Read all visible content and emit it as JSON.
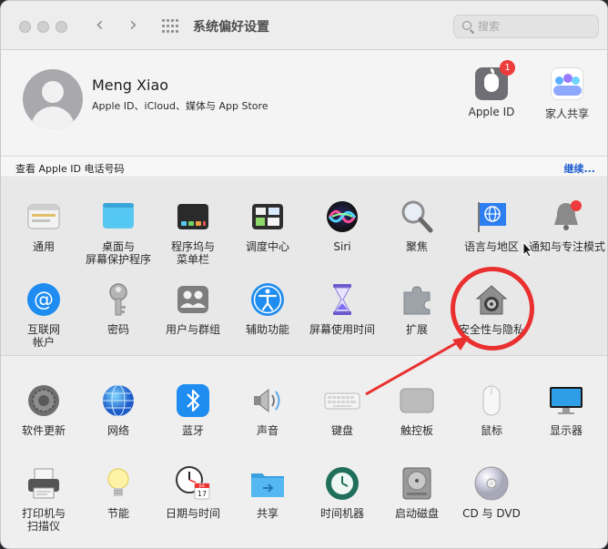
{
  "window": {
    "title": "系统偏好设置"
  },
  "search": {
    "placeholder": "搜索"
  },
  "profile": {
    "name": "Meng Xiao",
    "subtitle": "Apple ID、iCloud、媒体与 App Store",
    "apple_id": {
      "label": "Apple ID",
      "badge": "1"
    },
    "family": {
      "label": "家人共享"
    }
  },
  "appleid_row": {
    "left": "查看 Apple ID 电话号码",
    "right": "继续..."
  },
  "section_a": [
    {
      "name": "general",
      "label": "通用",
      "icon": "general-icon"
    },
    {
      "name": "desktop-screensaver",
      "label": "桌面与\n屏幕保护程序",
      "icon": "desktop-icon"
    },
    {
      "name": "dock-menubar",
      "label": "程序坞与\n菜单栏",
      "icon": "dock-icon"
    },
    {
      "name": "mission-control",
      "label": "调度中心",
      "icon": "mission-control-icon"
    },
    {
      "name": "siri",
      "label": "Siri",
      "icon": "siri-icon"
    },
    {
      "name": "spotlight",
      "label": "聚焦",
      "icon": "spotlight-icon"
    },
    {
      "name": "language-region",
      "label": "语言与地区",
      "icon": "globe-flag-icon"
    },
    {
      "name": "notifications-focus",
      "label": "通知与专注模式",
      "icon": "bell-icon"
    },
    {
      "name": "internet-accounts",
      "label": "互联网\n帐户",
      "icon": "at-icon"
    },
    {
      "name": "passwords",
      "label": "密码",
      "icon": "key-icon"
    },
    {
      "name": "users-groups",
      "label": "用户与群组",
      "icon": "users-icon"
    },
    {
      "name": "accessibility",
      "label": "辅助功能",
      "icon": "accessibility-icon"
    },
    {
      "name": "screen-time",
      "label": "屏幕使用时间",
      "icon": "hourglass-icon"
    },
    {
      "name": "extensions",
      "label": "扩展",
      "icon": "puzzle-icon"
    },
    {
      "name": "security-privacy",
      "label": "安全性与隐私",
      "icon": "house-lock-icon"
    }
  ],
  "section_b": [
    {
      "name": "software-update",
      "label": "软件更新",
      "icon": "gear-icon"
    },
    {
      "name": "network",
      "label": "网络",
      "icon": "network-globe-icon"
    },
    {
      "name": "bluetooth",
      "label": "蓝牙",
      "icon": "bluetooth-icon"
    },
    {
      "name": "sound",
      "label": "声音",
      "icon": "speaker-icon"
    },
    {
      "name": "keyboard",
      "label": "键盘",
      "icon": "keyboard-icon"
    },
    {
      "name": "trackpad",
      "label": "触控板",
      "icon": "trackpad-icon"
    },
    {
      "name": "mouse",
      "label": "鼠标",
      "icon": "mouse-icon"
    },
    {
      "name": "displays",
      "label": "显示器",
      "icon": "display-icon"
    },
    {
      "name": "printers-scanners",
      "label": "打印机与\n扫描仪",
      "icon": "printer-icon"
    },
    {
      "name": "energy",
      "label": "节能",
      "icon": "lightbulb-icon"
    },
    {
      "name": "date-time",
      "label": "日期与时间",
      "icon": "clock-calendar-icon"
    },
    {
      "name": "sharing",
      "label": "共享",
      "icon": "folder-share-icon"
    },
    {
      "name": "time-machine",
      "label": "时间机器",
      "icon": "time-machine-icon"
    },
    {
      "name": "startup-disk",
      "label": "启动磁盘",
      "icon": "disk-icon"
    },
    {
      "name": "cd-dvd",
      "label": "CD 与 DVD",
      "icon": "cd-icon"
    }
  ],
  "calendar_glyph": {
    "month": "JUL",
    "day": "17"
  }
}
